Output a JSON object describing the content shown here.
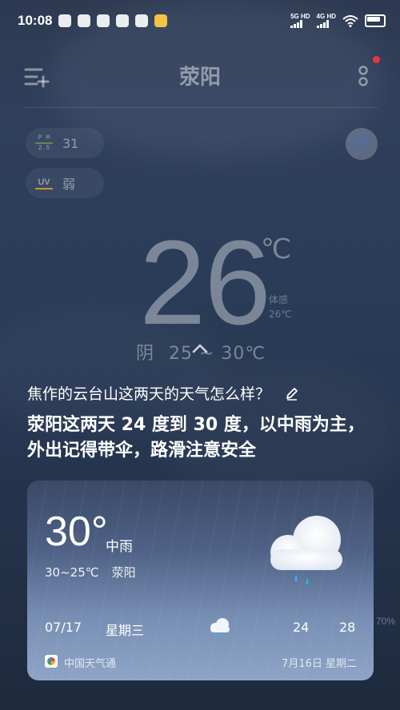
{
  "status_bar": {
    "time": "10:08",
    "net1": "5G HD",
    "net2": "4G HD"
  },
  "header": {
    "city": "荥阳"
  },
  "air": {
    "pm_label_top": "P M",
    "pm_label_bottom": "2.5",
    "pm_value": "31",
    "uv_label": "UV",
    "uv_value": "弱"
  },
  "current": {
    "temperature": "26",
    "unit": "℃",
    "feels_label": "体感",
    "feels_value": "26℃",
    "condition": "阴",
    "range": "25 ~ 30℃"
  },
  "assistant": {
    "query": "焦作的云台山这两天的天气怎么样？",
    "answer": "荥阳这两天 24 度到 30 度，以中雨为主，外出记得带伞，路滑注意安全"
  },
  "card": {
    "temperature": "30°",
    "condition": "中雨",
    "range": "30~25℃",
    "city": "荥阳",
    "forecast": {
      "date": "07/17",
      "weekday": "星期三",
      "low": "24",
      "high": "28"
    },
    "source": "中国天气通",
    "updated": "7月16日 星期二"
  },
  "side_value": "70%",
  "colors": {
    "accent_red": "#e3393c",
    "pm_green": "#6fa64a",
    "uv_yellow": "#c9962c"
  }
}
